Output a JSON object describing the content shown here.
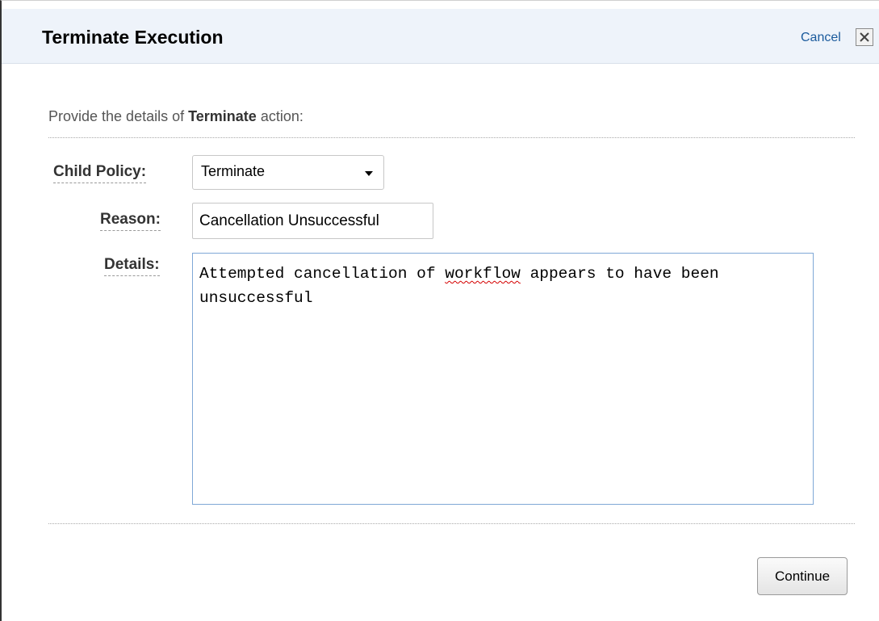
{
  "dialog": {
    "title": "Terminate Execution",
    "cancel_label": "Cancel",
    "close_icon": "close-icon"
  },
  "intro": {
    "prefix": "Provide the details of ",
    "emphasis": "Terminate",
    "suffix": " action:"
  },
  "form": {
    "child_policy": {
      "label": "Child Policy:",
      "selected": "Terminate"
    },
    "reason": {
      "label": "Reason:",
      "value": "Cancellation Unsuccessful"
    },
    "details": {
      "label": "Details:",
      "before": "Attempted cancellation of ",
      "misspelled": "workflow",
      "after": " appears to have been unsuccessful"
    }
  },
  "footer": {
    "continue_label": "Continue"
  },
  "colors": {
    "header_bg": "#eef3fa",
    "link": "#1a5a9c",
    "textarea_border": "#7fa8d6",
    "spell_underline": "#d40000"
  }
}
